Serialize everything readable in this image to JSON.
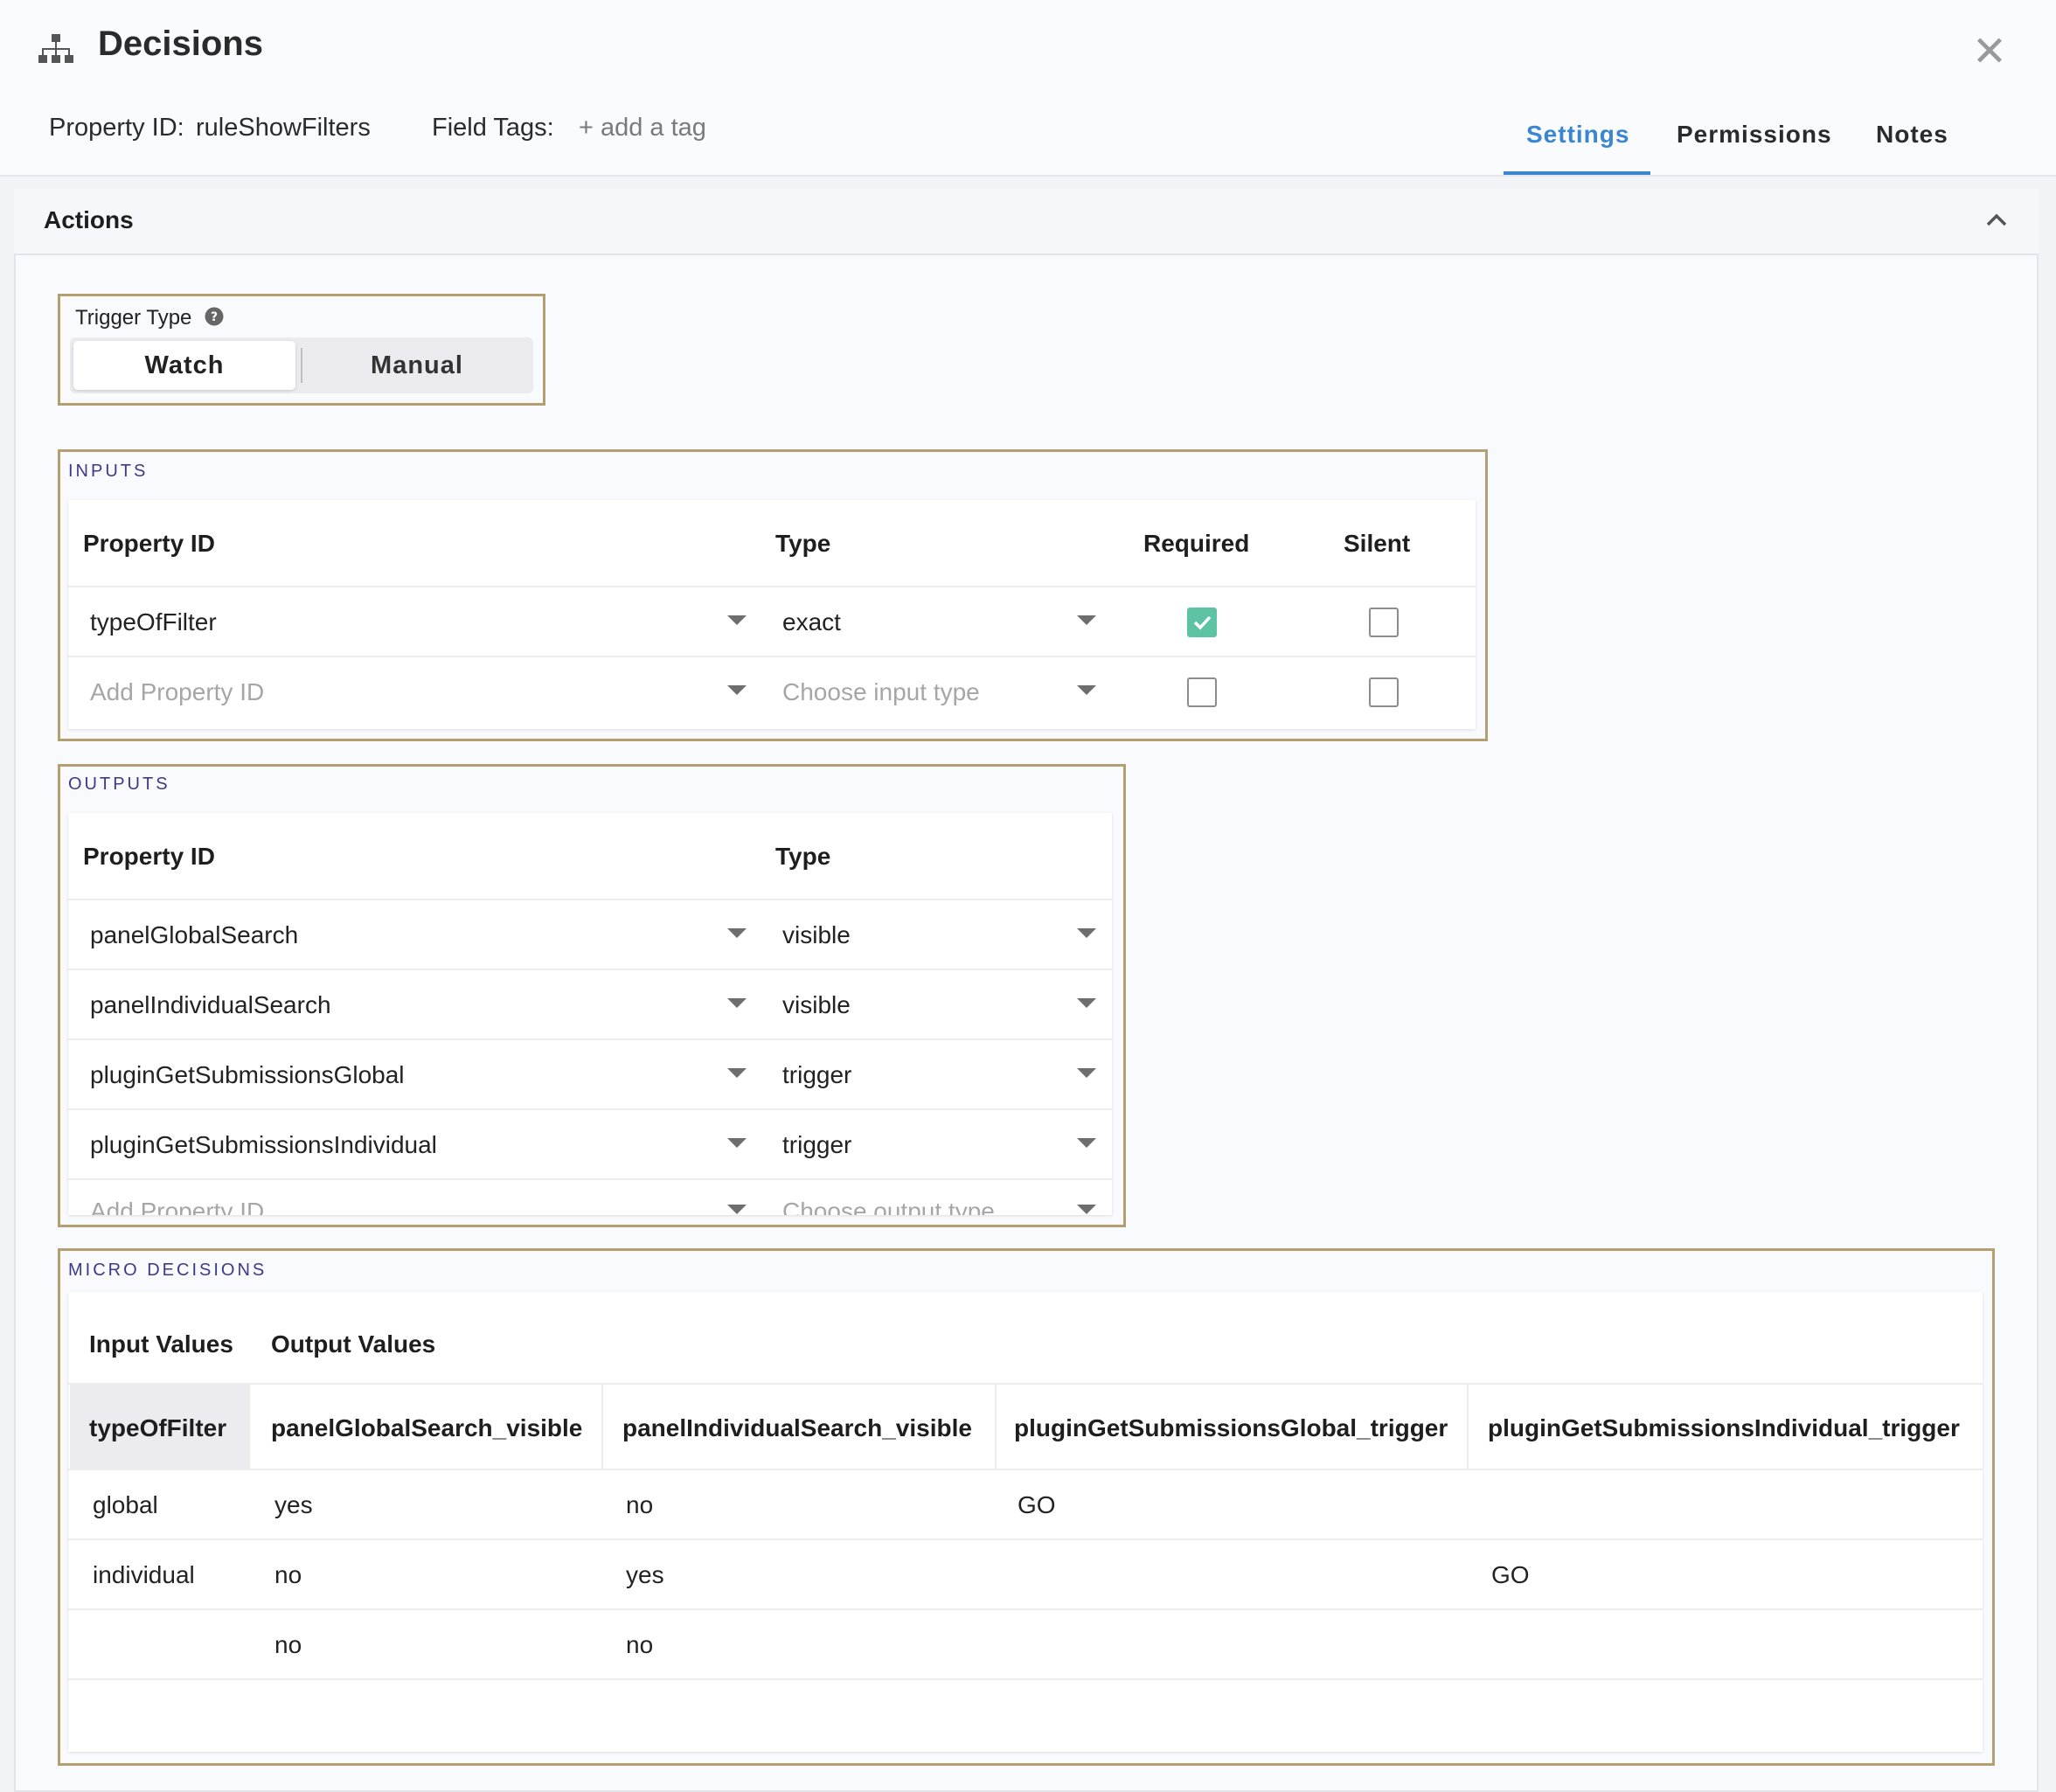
{
  "header": {
    "title": "Decisions",
    "title_icon": "sitemap-icon",
    "close_icon": "close-icon",
    "close_glyph": "✕",
    "property_id_label": "Property ID:",
    "property_id_value": "ruleShowFilters",
    "field_tags_label": "Field Tags:",
    "add_tag_label": "+ add a tag",
    "tabs": [
      {
        "label": "Settings",
        "active": true
      },
      {
        "label": "Permissions",
        "active": false
      },
      {
        "label": "Notes",
        "active": false
      }
    ]
  },
  "panel": {
    "title": "Actions",
    "collapse_icon": "chevron-up-icon"
  },
  "trigger": {
    "label": "Trigger Type",
    "help_icon": "question-circle-icon",
    "options": [
      "Watch",
      "Manual"
    ],
    "selected": "Watch"
  },
  "inputs": {
    "section_label": "INPUTS",
    "columns": [
      "Property ID",
      "Type",
      "Required",
      "Silent"
    ],
    "rows": [
      {
        "property_id": "typeOfFilter",
        "type": "exact",
        "required": true,
        "silent": false
      }
    ],
    "new_row": {
      "property_placeholder": "Add Property ID",
      "type_placeholder": "Choose input type"
    }
  },
  "outputs": {
    "section_label": "OUTPUTS",
    "columns": [
      "Property ID",
      "Type"
    ],
    "rows": [
      {
        "property_id": "panelGlobalSearch",
        "type": "visible"
      },
      {
        "property_id": "panelIndividualSearch",
        "type": "visible"
      },
      {
        "property_id": "pluginGetSubmissionsGlobal",
        "type": "trigger"
      },
      {
        "property_id": "pluginGetSubmissionsIndividual",
        "type": "trigger"
      }
    ],
    "new_row": {
      "property_placeholder": "Add Property ID",
      "type_placeholder": "Choose output type"
    }
  },
  "micro_decisions": {
    "section_label": "MICRO DECISIONS",
    "group_headers": [
      "Input Values",
      "Output Values"
    ],
    "columns": [
      "typeOfFilter",
      "panelGlobalSearch_visible",
      "panelIndividualSearch_visible",
      "pluginGetSubmissionsGlobal_trigger",
      "pluginGetSubmissionsIndividual_trigger"
    ],
    "rows": [
      [
        "global",
        "yes",
        "no",
        "GO",
        ""
      ],
      [
        "individual",
        "no",
        "yes",
        "",
        "GO"
      ],
      [
        "",
        "no",
        "no",
        "",
        ""
      ]
    ]
  },
  "colors": {
    "accent": "#3a86d1",
    "highlight_border": "#b39f6f",
    "section_label": "#3b3a8a",
    "checkbox_checked": "#5ec3a4"
  }
}
